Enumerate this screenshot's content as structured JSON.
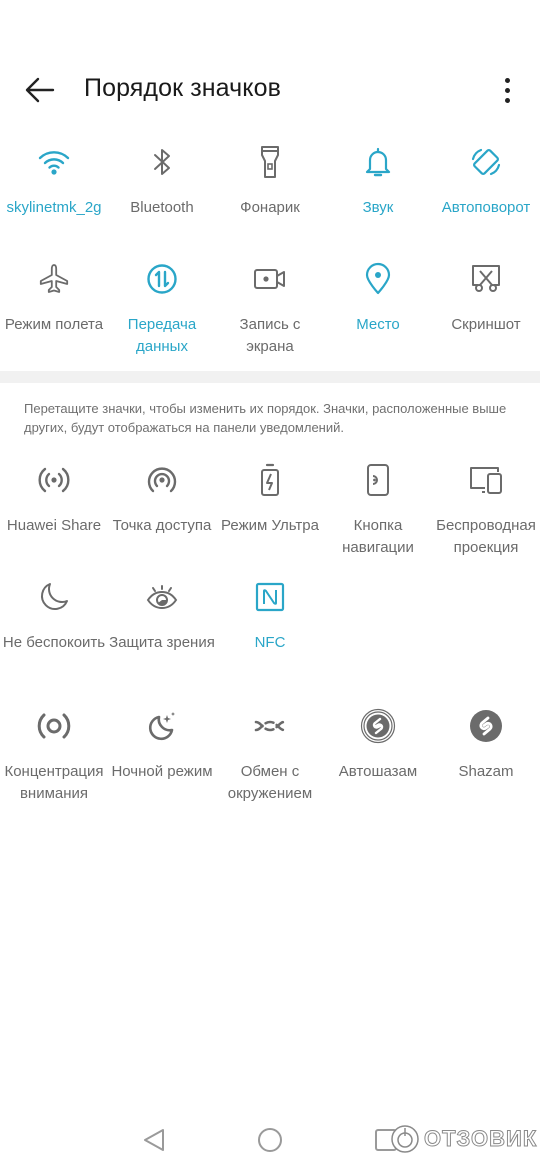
{
  "header": {
    "title": "Порядок значков",
    "back_icon": "arrow-left-icon",
    "more_icon": "more-vertical-icon"
  },
  "colors": {
    "accent": "#2aa6c8",
    "inactive": "#6b6b6b",
    "divider": "#f1f1f1"
  },
  "active_tiles": [
    {
      "label": "skylinetmk_2g",
      "icon": "wifi-icon",
      "active": true
    },
    {
      "label": "Bluetooth",
      "icon": "bluetooth-icon",
      "active": false
    },
    {
      "label": "Фонарик",
      "icon": "flashlight-icon",
      "active": false
    },
    {
      "label": "Звук",
      "icon": "bell-icon",
      "active": true
    },
    {
      "label": "Автоповорот",
      "icon": "auto-rotate-icon",
      "active": true
    },
    {
      "label": "Режим полета",
      "icon": "airplane-icon",
      "active": false
    },
    {
      "label": "Передача\nданных",
      "icon": "mobile-data-icon",
      "active": true
    },
    {
      "label": "Запись с\nэкрана",
      "icon": "screen-record-icon",
      "active": false
    },
    {
      "label": "Место",
      "icon": "location-pin-icon",
      "active": true
    },
    {
      "label": "Скриншот",
      "icon": "screenshot-icon",
      "active": false
    }
  ],
  "hint": "Перетащите значки, чтобы изменить их порядок. Значки, расположенные выше других, будут отображаться на панели уведомлений.",
  "inactive_tiles": [
    {
      "label": "Huawei Share",
      "icon": "huawei-share-icon",
      "active": false
    },
    {
      "label": "Точка доступа",
      "icon": "hotspot-icon",
      "active": false
    },
    {
      "label": "Режим Ультра",
      "icon": "battery-ultra-icon",
      "active": false
    },
    {
      "label": "Кнопка\nнавигации",
      "icon": "nav-button-icon",
      "active": false
    },
    {
      "label": "Беспроводная\nпроекция",
      "icon": "wireless-projection-icon",
      "active": false
    },
    {
      "label": "Не беспокоить",
      "icon": "moon-icon",
      "active": false
    },
    {
      "label": "Защита зрения",
      "icon": "eye-icon",
      "active": false
    },
    {
      "label": "NFC",
      "icon": "nfc-icon",
      "active": true
    }
  ],
  "extra_tiles": [
    {
      "label": "Концентрация\nвнимания",
      "icon": "focus-icon",
      "active": false
    },
    {
      "label": "Ночной режим",
      "icon": "night-mode-icon",
      "active": false
    },
    {
      "label": "Обмен с\nокружением",
      "icon": "nearby-share-icon",
      "active": false
    },
    {
      "label": "Автошазам",
      "icon": "auto-shazam-icon",
      "active": false
    },
    {
      "label": "Shazam",
      "icon": "shazam-icon",
      "active": false
    }
  ],
  "navbar": {
    "back_icon": "nav-back-icon",
    "home_icon": "nav-home-icon",
    "recents_icon": "nav-recents-icon"
  },
  "watermark": "ОТЗОВИК"
}
